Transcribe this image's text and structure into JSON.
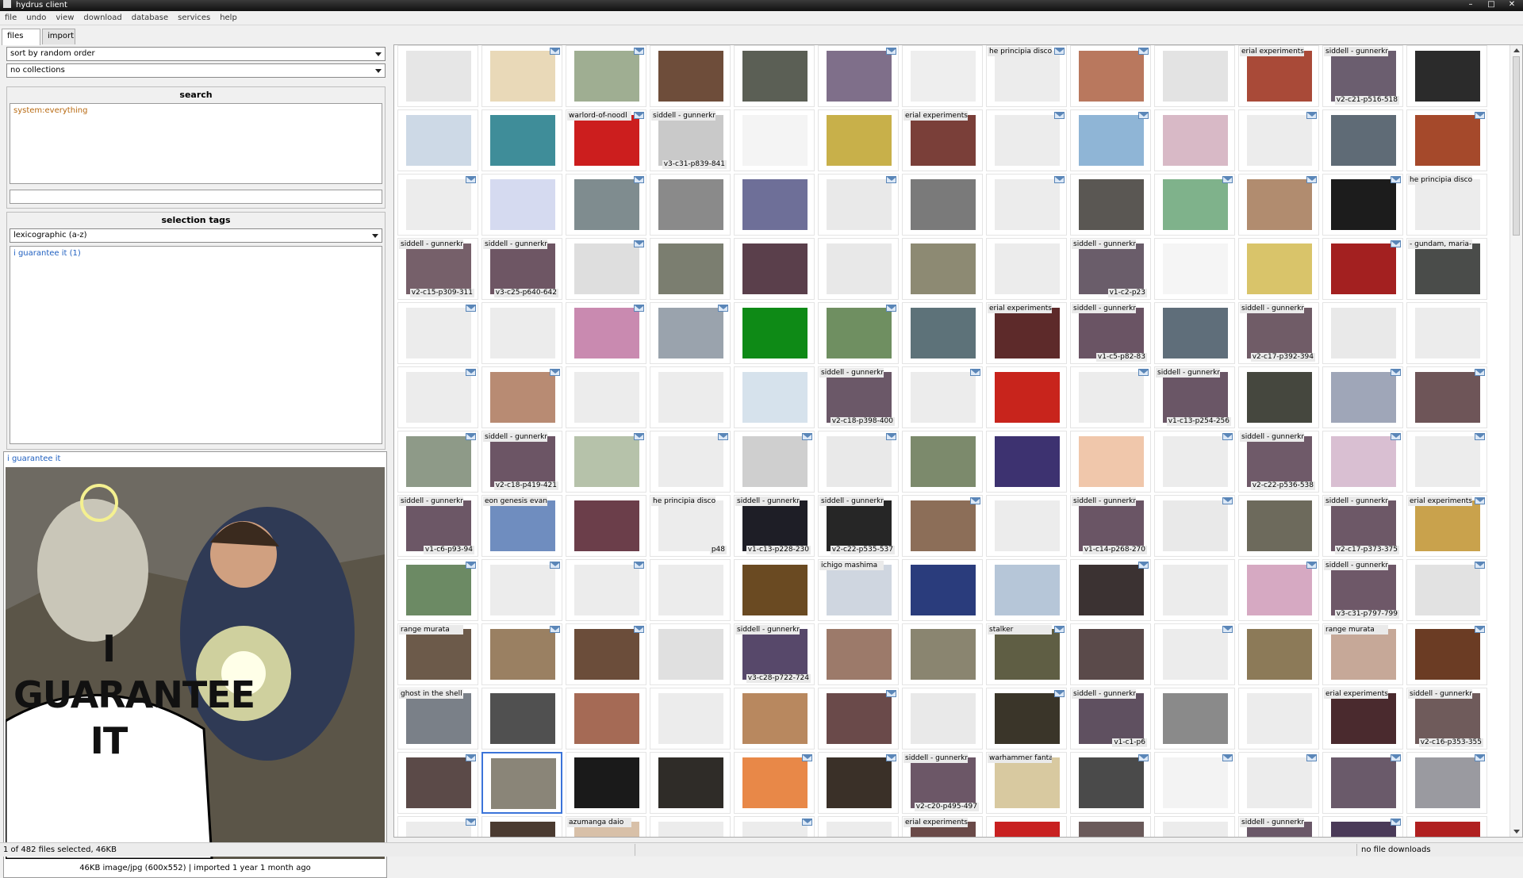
{
  "window": {
    "title": "hydrus client"
  },
  "menu": [
    "file",
    "undo",
    "view",
    "download",
    "database",
    "services",
    "help"
  ],
  "tabs": [
    {
      "label": "files",
      "active": true
    },
    {
      "label": "import",
      "active": false
    }
  ],
  "sidebar": {
    "sort": "sort by random order",
    "collections": "no collections",
    "search_header": "search",
    "search_predicate": "system:everything",
    "search_input": "",
    "selection_tags_header": "selection tags",
    "tag_sort": "lexicographic (a-z)",
    "selected_tag": "i guarantee it (1)"
  },
  "preview": {
    "tag": "i guarantee it",
    "caption": "I GUARANTEE IT",
    "info": "46KB image/jpg (600x552) | imported 1 year 1 month ago"
  },
  "thumbnails": [
    {
      "cap": "",
      "page": "",
      "c": "#e6e6e6",
      "mail": false
    },
    {
      "cap": "",
      "page": "",
      "c": "#e9d9b8",
      "mail": true
    },
    {
      "cap": "",
      "page": "",
      "c": "#9fae92",
      "mail": true
    },
    {
      "cap": "",
      "page": "",
      "c": "#6e4d3a",
      "mail": false
    },
    {
      "cap": "",
      "page": "",
      "c": "#5b5f55",
      "mail": false
    },
    {
      "cap": "",
      "page": "",
      "c": "#7f6f8a",
      "mail": true
    },
    {
      "cap": "",
      "page": "",
      "c": "#eeeeee",
      "mail": false
    },
    {
      "cap": "he principia disco",
      "page": "",
      "c": "#ececec",
      "mail": true
    },
    {
      "cap": "",
      "page": "",
      "c": "#b9785e",
      "mail": true
    },
    {
      "cap": "",
      "page": "",
      "c": "#e3e3e3",
      "mail": false
    },
    {
      "cap": "erial experiments lai",
      "page": "",
      "c": "#a94a38",
      "mail": false
    },
    {
      "cap": "siddell - gunnerkri",
      "page": "v2-c21-p516-518",
      "c": "#6b5e6f",
      "mail": false
    },
    {
      "cap": "",
      "page": "",
      "c": "#2b2b2b",
      "mail": false
    },
    {
      "cap": "",
      "page": "",
      "c": "#cdd9e6",
      "mail": false
    },
    {
      "cap": "",
      "page": "",
      "c": "#3f8d99",
      "mail": false
    },
    {
      "cap": "warlord-of-noodl",
      "page": "",
      "c": "#cc1e1e",
      "mail": true
    },
    {
      "cap": "siddell - gunnerkrigg c",
      "page": "v3-c31-p839-841",
      "c": "#c9c9c9",
      "mail": false
    },
    {
      "cap": "",
      "page": "",
      "c": "#f4f4f4",
      "mail": false
    },
    {
      "cap": "",
      "page": "",
      "c": "#c8b04a",
      "mail": false
    },
    {
      "cap": "erial experiments lai",
      "page": "",
      "c": "#7a3f39",
      "mail": false
    },
    {
      "cap": "",
      "page": "",
      "c": "#ececec",
      "mail": true
    },
    {
      "cap": "",
      "page": "",
      "c": "#8fb5d6",
      "mail": true
    },
    {
      "cap": "",
      "page": "",
      "c": "#d8b9c6",
      "mail": false
    },
    {
      "cap": "",
      "page": "",
      "c": "#ececec",
      "mail": true
    },
    {
      "cap": "",
      "page": "",
      "c": "#5f6b76",
      "mail": false
    },
    {
      "cap": "",
      "page": "",
      "c": "#a5492b",
      "mail": true
    },
    {
      "cap": "",
      "page": "",
      "c": "#ececec",
      "mail": true
    },
    {
      "cap": "",
      "page": "",
      "c": "#d5daf0",
      "mail": false
    },
    {
      "cap": "",
      "page": "",
      "c": "#7f8c8f",
      "mail": true
    },
    {
      "cap": "",
      "page": "",
      "c": "#8a8a8a",
      "mail": false
    },
    {
      "cap": "",
      "page": "",
      "c": "#6e6f98",
      "mail": false
    },
    {
      "cap": "",
      "page": "",
      "c": "#e9e9e9",
      "mail": true
    },
    {
      "cap": "",
      "page": "",
      "c": "#7a7a7a",
      "mail": false
    },
    {
      "cap": "",
      "page": "",
      "c": "#ececec",
      "mail": true
    },
    {
      "cap": "",
      "page": "",
      "c": "#5a5753",
      "mail": false
    },
    {
      "cap": "",
      "page": "",
      "c": "#7fb28b",
      "mail": true
    },
    {
      "cap": "",
      "page": "",
      "c": "#b18c6f",
      "mail": true
    },
    {
      "cap": "",
      "page": "",
      "c": "#1c1c1c",
      "mail": true
    },
    {
      "cap": "he principia discordi",
      "page": "",
      "c": "#ececec",
      "mail": false
    },
    {
      "cap": "siddell - gunnerkrigg c",
      "page": "v2-c15-p309-311",
      "c": "#76606a",
      "mail": false
    },
    {
      "cap": "siddell - gunnerkrigg c",
      "page": "v3-c25-p640-642",
      "c": "#6e5664",
      "mail": false
    },
    {
      "cap": "",
      "page": "",
      "c": "#dedede",
      "mail": true
    },
    {
      "cap": "",
      "page": "",
      "c": "#7b7e70",
      "mail": false
    },
    {
      "cap": "",
      "page": "",
      "c": "#5a3f4b",
      "mail": false
    },
    {
      "cap": "",
      "page": "",
      "c": "#e8e8e8",
      "mail": false
    },
    {
      "cap": "",
      "page": "",
      "c": "#8d8a73",
      "mail": false
    },
    {
      "cap": "",
      "page": "",
      "c": "#ececec",
      "mail": false
    },
    {
      "cap": "siddell - gunnerkri",
      "page": "v1-c2-p23",
      "c": "#6a5d6a",
      "mail": false
    },
    {
      "cap": "",
      "page": "",
      "c": "#f5f5f5",
      "mail": false
    },
    {
      "cap": "",
      "page": "",
      "c": "#d9c46a",
      "mail": false
    },
    {
      "cap": "",
      "page": "",
      "c": "#a32020",
      "mail": true
    },
    {
      "cap": "- gundam, maria-",
      "page": "",
      "c": "#4a4c4a",
      "mail": false
    },
    {
      "cap": "",
      "page": "",
      "c": "#ececec",
      "mail": true
    },
    {
      "cap": "",
      "page": "",
      "c": "#ececec",
      "mail": false
    },
    {
      "cap": "",
      "page": "",
      "c": "#c98ab0",
      "mail": true
    },
    {
      "cap": "",
      "page": "",
      "c": "#9aa3ad",
      "mail": true
    },
    {
      "cap": "",
      "page": "",
      "c": "#0e8a16",
      "mail": false
    },
    {
      "cap": "",
      "page": "",
      "c": "#6f8f61",
      "mail": true
    },
    {
      "cap": "",
      "page": "",
      "c": "#5d7279",
      "mail": false
    },
    {
      "cap": "erial experiments lai",
      "page": "",
      "c": "#5d2a2a",
      "mail": false
    },
    {
      "cap": "siddell - gunnerkri",
      "page": "v1-c5-p82-83",
      "c": "#6a5464",
      "mail": false
    },
    {
      "cap": "",
      "page": "",
      "c": "#5f6e7a",
      "mail": false
    },
    {
      "cap": "siddell - gunnerkri",
      "page": "v2-c17-p392-394",
      "c": "#705c67",
      "mail": false
    },
    {
      "cap": "",
      "page": "",
      "c": "#e9e9e9",
      "mail": false
    },
    {
      "cap": "",
      "page": "",
      "c": "#ececec",
      "mail": false
    },
    {
      "cap": "",
      "page": "",
      "c": "#ececec",
      "mail": true
    },
    {
      "cap": "",
      "page": "",
      "c": "#b88b73",
      "mail": true
    },
    {
      "cap": "",
      "page": "",
      "c": "#ececec",
      "mail": false
    },
    {
      "cap": "",
      "page": "",
      "c": "#ececec",
      "mail": false
    },
    {
      "cap": "",
      "page": "",
      "c": "#d6e2ec",
      "mail": false
    },
    {
      "cap": "siddell - gunnerkri",
      "page": "v2-c18-p398-400",
      "c": "#6b5868",
      "mail": false
    },
    {
      "cap": "",
      "page": "",
      "c": "#ececec",
      "mail": true
    },
    {
      "cap": "",
      "page": "",
      "c": "#c8241c",
      "mail": false
    },
    {
      "cap": "",
      "page": "",
      "c": "#ececec",
      "mail": true
    },
    {
      "cap": "siddell - gunnerkrigg c",
      "page": "v1-c13-p254-256",
      "c": "#6a5666",
      "mail": false
    },
    {
      "cap": "",
      "page": "",
      "c": "#45473e",
      "mail": false
    },
    {
      "cap": "",
      "page": "",
      "c": "#9fa6b8",
      "mail": true
    },
    {
      "cap": "",
      "page": "",
      "c": "#6e5558",
      "mail": true
    },
    {
      "cap": "",
      "page": "",
      "c": "#8e9a88",
      "mail": true
    },
    {
      "cap": "siddell - gunnerkri",
      "page": "v2-c18-p419-421",
      "c": "#6c5565",
      "mail": false
    },
    {
      "cap": "",
      "page": "",
      "c": "#b6c2aa",
      "mail": true
    },
    {
      "cap": "",
      "page": "",
      "c": "#ececec",
      "mail": true
    },
    {
      "cap": "",
      "page": "",
      "c": "#cfcfcf",
      "mail": true
    },
    {
      "cap": "",
      "page": "",
      "c": "#e9e9e9",
      "mail": true
    },
    {
      "cap": "",
      "page": "",
      "c": "#7c8a6c",
      "mail": false
    },
    {
      "cap": "",
      "page": "",
      "c": "#3d3270",
      "mail": false
    },
    {
      "cap": "",
      "page": "",
      "c": "#f0c7ab",
      "mail": false
    },
    {
      "cap": "",
      "page": "",
      "c": "#ececec",
      "mail": true
    },
    {
      "cap": "siddell - gunnerkrigg c",
      "page": "v2-c22-p536-538",
      "c": "#6f5a69",
      "mail": false
    },
    {
      "cap": "",
      "page": "",
      "c": "#d9bfd2",
      "mail": true
    },
    {
      "cap": "",
      "page": "",
      "c": "#ececec",
      "mail": true
    },
    {
      "cap": "siddell - gunnerkri",
      "page": "v1-c6-p93-94",
      "c": "#6c5766",
      "mail": false
    },
    {
      "cap": "eon genesis evangelic",
      "page": "",
      "c": "#6f8dbf",
      "mail": false
    },
    {
      "cap": "",
      "page": "",
      "c": "#6b3e4a",
      "mail": false
    },
    {
      "cap": "he principia disco",
      "page": "p48",
      "c": "#ececec",
      "mail": false
    },
    {
      "cap": "siddell - gunnerkri",
      "page": "v1-c13-p228-230",
      "c": "#1e1e26",
      "mail": false
    },
    {
      "cap": "siddell - gunnerkrigg c",
      "page": "v2-c22-p535-537",
      "c": "#262626",
      "mail": false
    },
    {
      "cap": "",
      "page": "",
      "c": "#8c6e58",
      "mail": true
    },
    {
      "cap": "",
      "page": "",
      "c": "#ececec",
      "mail": false
    },
    {
      "cap": "siddell - gunnerkri",
      "page": "v1-c14-p268-270",
      "c": "#6a5565",
      "mail": false
    },
    {
      "cap": "",
      "page": "",
      "c": "#e9e9e9",
      "mail": true
    },
    {
      "cap": "",
      "page": "",
      "c": "#6d6a5c",
      "mail": false
    },
    {
      "cap": "siddell - gunnerkrigg c",
      "page": "v2-c17-p373-375",
      "c": "#6d5867",
      "mail": false
    },
    {
      "cap": "erial experiments",
      "page": "",
      "c": "#c9a24c",
      "mail": true
    },
    {
      "cap": "",
      "page": "",
      "c": "#6c8a64",
      "mail": true
    },
    {
      "cap": "",
      "page": "",
      "c": "#ececec",
      "mail": true
    },
    {
      "cap": "",
      "page": "",
      "c": "#ececec",
      "mail": true
    },
    {
      "cap": "",
      "page": "",
      "c": "#ececec",
      "mail": false
    },
    {
      "cap": "",
      "page": "",
      "c": "#6a4a22",
      "mail": false
    },
    {
      "cap": "ichigo mashima",
      "page": "",
      "c": "#cfd6e0",
      "mail": false
    },
    {
      "cap": "",
      "page": "",
      "c": "#2a3c7c",
      "mail": false
    },
    {
      "cap": "",
      "page": "",
      "c": "#b6c6d8",
      "mail": false
    },
    {
      "cap": "",
      "page": "",
      "c": "#3b3232",
      "mail": true
    },
    {
      "cap": "",
      "page": "",
      "c": "#ececec",
      "mail": false
    },
    {
      "cap": "",
      "page": "",
      "c": "#d6a9c2",
      "mail": true
    },
    {
      "cap": "siddell - gunnerkri",
      "page": "v3-c31-p797-799",
      "c": "#6e5868",
      "mail": false
    },
    {
      "cap": "",
      "page": "",
      "c": "#e2e2e2",
      "mail": true
    },
    {
      "cap": "range murata",
      "page": "",
      "c": "#6c5a4a",
      "mail": false
    },
    {
      "cap": "",
      "page": "",
      "c": "#9a8062",
      "mail": true
    },
    {
      "cap": "",
      "page": "",
      "c": "#6b4d3a",
      "mail": true
    },
    {
      "cap": "",
      "page": "",
      "c": "#e0e0e0",
      "mail": false
    },
    {
      "cap": "siddell - gunnerkri",
      "page": "v3-c28-p722-724",
      "c": "#57486a",
      "mail": false
    },
    {
      "cap": "",
      "page": "",
      "c": "#9c7a6a",
      "mail": false
    },
    {
      "cap": "",
      "page": "",
      "c": "#8a8570",
      "mail": false
    },
    {
      "cap": "stalker",
      "page": "",
      "c": "#5f5e44",
      "mail": true
    },
    {
      "cap": "",
      "page": "",
      "c": "#5a4a4a",
      "mail": false
    },
    {
      "cap": "",
      "page": "",
      "c": "#ececec",
      "mail": true
    },
    {
      "cap": "",
      "page": "",
      "c": "#8c7a58",
      "mail": false
    },
    {
      "cap": "range murata",
      "page": "",
      "c": "#c6a898",
      "mail": false
    },
    {
      "cap": "",
      "page": "",
      "c": "#6b3c24",
      "mail": true
    },
    {
      "cap": "ghost in the shell",
      "page": "",
      "c": "#7a8088",
      "mail": false
    },
    {
      "cap": "",
      "page": "",
      "c": "#505050",
      "mail": false
    },
    {
      "cap": "",
      "page": "",
      "c": "#a56a55",
      "mail": false
    },
    {
      "cap": "",
      "page": "",
      "c": "#ececec",
      "mail": false
    },
    {
      "cap": "",
      "page": "",
      "c": "#b8885f",
      "mail": false
    },
    {
      "cap": "",
      "page": "",
      "c": "#6a4a4a",
      "mail": true
    },
    {
      "cap": "",
      "page": "",
      "c": "#e9e9e9",
      "mail": false
    },
    {
      "cap": "",
      "page": "",
      "c": "#3a3529",
      "mail": true
    },
    {
      "cap": "siddell - gunnerkri",
      "page": "v1-c1-p6",
      "c": "#5f5060",
      "mail": false
    },
    {
      "cap": "",
      "page": "",
      "c": "#8a8a8a",
      "mail": false
    },
    {
      "cap": "",
      "page": "",
      "c": "#ececec",
      "mail": false
    },
    {
      "cap": "erial experiments lai",
      "page": "",
      "c": "#4a2a2e",
      "mail": false
    },
    {
      "cap": "siddell - gunnerkrigg c",
      "page": "v2-c16-p353-355",
      "c": "#6f5b5b",
      "mail": false
    },
    {
      "cap": "",
      "page": "",
      "c": "#5b4a48",
      "mail": true
    },
    {
      "cap": "",
      "page": "",
      "c": "#8a8578",
      "mail": false,
      "sel": true
    },
    {
      "cap": "",
      "page": "",
      "c": "#1a1a1a",
      "mail": false
    },
    {
      "cap": "",
      "page": "",
      "c": "#2f2c28",
      "mail": false
    },
    {
      "cap": "",
      "page": "",
      "c": "#e88848",
      "mail": true
    },
    {
      "cap": "",
      "page": "",
      "c": "#3a3028",
      "mail": true
    },
    {
      "cap": "siddell - gunnerkrigg c",
      "page": "v2-c20-p495-497",
      "c": "#6c5767",
      "mail": false
    },
    {
      "cap": "warhammer fantasy",
      "page": "",
      "c": "#d8c9a0",
      "mail": false
    },
    {
      "cap": "",
      "page": "",
      "c": "#4a4a4a",
      "mail": true
    },
    {
      "cap": "",
      "page": "",
      "c": "#f3f3f3",
      "mail": true
    },
    {
      "cap": "",
      "page": "",
      "c": "#ececec",
      "mail": true
    },
    {
      "cap": "",
      "page": "",
      "c": "#6a5a6a",
      "mail": true
    },
    {
      "cap": "",
      "page": "",
      "c": "#9a9aa0",
      "mail": true
    },
    {
      "cap": "",
      "page": "",
      "c": "#ececec",
      "mail": true
    },
    {
      "cap": "",
      "page": "",
      "c": "#4a3a30",
      "mail": false
    },
    {
      "cap": "azumanga daio",
      "page": "",
      "c": "#d8c0a8",
      "mail": false
    },
    {
      "cap": "",
      "page": "",
      "c": "#ececec",
      "mail": false
    },
    {
      "cap": "",
      "page": "",
      "c": "#ececec",
      "mail": true
    },
    {
      "cap": "",
      "page": "",
      "c": "#ececec",
      "mail": false
    },
    {
      "cap": "erial experiments lai",
      "page": "",
      "c": "#6a4a48",
      "mail": false
    },
    {
      "cap": "",
      "page": "",
      "c": "#c82020",
      "mail": false
    },
    {
      "cap": "",
      "page": "",
      "c": "#6a5a5a",
      "mail": false
    },
    {
      "cap": "",
      "page": "",
      "c": "#ececec",
      "mail": false
    },
    {
      "cap": "siddell - gunnerkrigg c",
      "page": "",
      "c": "#6a5868",
      "mail": false
    },
    {
      "cap": "",
      "page": "",
      "c": "#4a3a58",
      "mail": true
    },
    {
      "cap": "",
      "page": "",
      "c": "#b02020",
      "mail": false
    }
  ],
  "status": {
    "left": "1 of 482 files selected, 46KB",
    "right": "no file downloads"
  }
}
